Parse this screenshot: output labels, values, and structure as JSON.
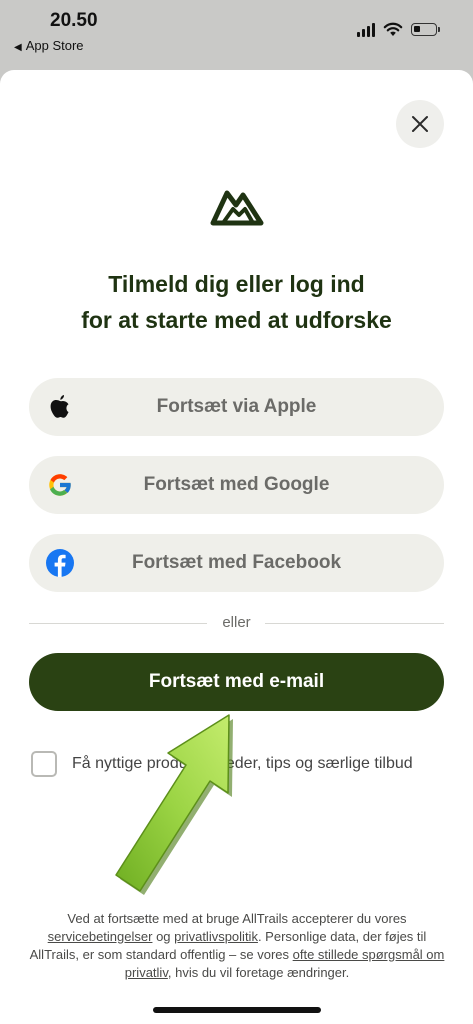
{
  "status_bar": {
    "time": "20.50",
    "back_app": "App Store"
  },
  "sheet": {
    "headline_line1": "Tilmeld dig eller log ind",
    "headline_line2": "for at starte med at udforske",
    "buttons": {
      "apple": "Fortsæt via Apple",
      "google": "Fortsæt med Google",
      "facebook": "Fortsæt med Facebook",
      "email": "Fortsæt med e-mail"
    },
    "divider_text": "eller",
    "checkbox_label": "Få nyttige produktnyheder, tips og særlige tilbud",
    "legal": {
      "part1": "Ved at fortsætte med at bruge AllTrails accepterer du vores ",
      "terms_link": "servicebetingelser",
      "part2": " og ",
      "privacy_link": "privatlivspolitik",
      "part3": ". Personlige data, der føjes til AllTrails, er som standard offentlig – se vores ",
      "faq_link": "ofte stillede spørgsmål om privatliv",
      "part4": ", hvis du vil foretage ændringer."
    }
  },
  "colors": {
    "primary": "#2a4213",
    "headline": "#1f3312",
    "button_bg": "#efefea",
    "arrow": "#8cc63f",
    "facebook": "#1877f2"
  },
  "icons": [
    "close-icon",
    "alltrails-logo",
    "apple-icon",
    "google-icon",
    "facebook-icon",
    "arrow-annotation"
  ]
}
